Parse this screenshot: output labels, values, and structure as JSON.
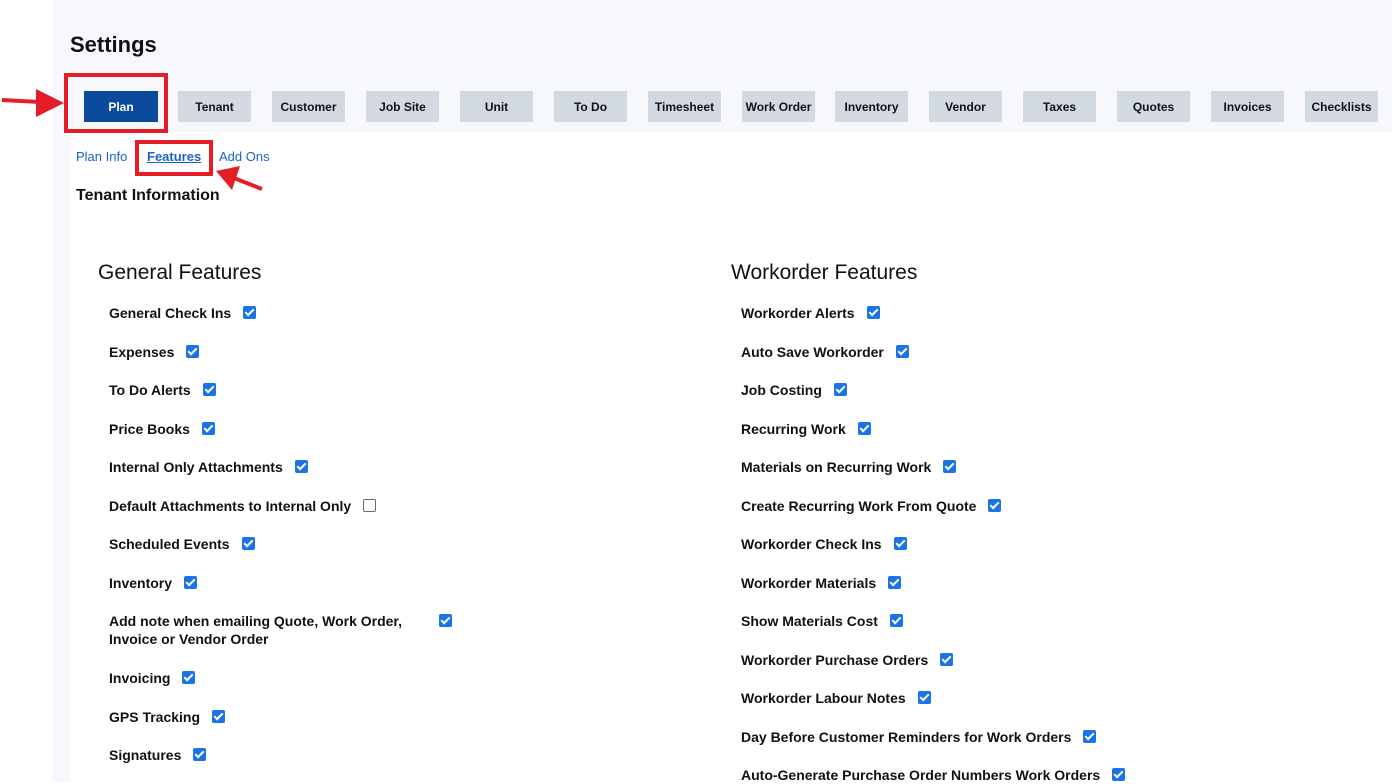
{
  "page": {
    "title": "Settings"
  },
  "tabs": [
    {
      "label": "Plan",
      "active": true
    },
    {
      "label": "Tenant"
    },
    {
      "label": "Customer"
    },
    {
      "label": "Job Site"
    },
    {
      "label": "Unit"
    },
    {
      "label": "To Do"
    },
    {
      "label": "Timesheet"
    },
    {
      "label": "Work Order"
    },
    {
      "label": "Inventory"
    },
    {
      "label": "Vendor"
    },
    {
      "label": "Taxes"
    },
    {
      "label": "Quotes"
    },
    {
      "label": "Invoices"
    },
    {
      "label": "Checklists"
    }
  ],
  "subnav": [
    {
      "label": "Plan Info"
    },
    {
      "label": "Features",
      "active": true
    },
    {
      "label": "Add Ons"
    }
  ],
  "section": {
    "title": "Tenant Information"
  },
  "general": {
    "title": "General Features",
    "items": [
      {
        "label": "General Check Ins",
        "checked": true
      },
      {
        "label": "Expenses",
        "checked": true
      },
      {
        "label": "To Do Alerts",
        "checked": true
      },
      {
        "label": "Price Books",
        "checked": true
      },
      {
        "label": "Internal Only Attachments",
        "checked": true
      },
      {
        "label": "Default Attachments to Internal Only",
        "checked": false
      },
      {
        "label": "Scheduled Events",
        "checked": true
      },
      {
        "label": "Inventory",
        "checked": true
      },
      {
        "label": "Add note when emailing Quote, Work Order, Invoice or Vendor Order",
        "checked": true
      },
      {
        "label": "Invoicing",
        "checked": true
      },
      {
        "label": "GPS Tracking",
        "checked": true
      },
      {
        "label": "Signatures",
        "checked": true
      }
    ]
  },
  "workorder": {
    "title": "Workorder Features",
    "items": [
      {
        "label": "Workorder Alerts",
        "checked": true
      },
      {
        "label": "Auto Save Workorder",
        "checked": true
      },
      {
        "label": "Job Costing",
        "checked": true
      },
      {
        "label": "Recurring Work",
        "checked": true
      },
      {
        "label": "Materials on Recurring Work",
        "checked": true
      },
      {
        "label": "Create Recurring Work From Quote",
        "checked": true
      },
      {
        "label": "Workorder Check Ins",
        "checked": true
      },
      {
        "label": "Workorder Materials",
        "checked": true
      },
      {
        "label": "Show Materials Cost",
        "checked": true
      },
      {
        "label": "Workorder Purchase Orders",
        "checked": true
      },
      {
        "label": "Workorder Labour Notes",
        "checked": true
      },
      {
        "label": "Day Before Customer Reminders for Work Orders",
        "checked": true
      },
      {
        "label": "Auto-Generate Purchase Order Numbers Work Orders",
        "checked": true
      }
    ]
  },
  "colors": {
    "accent": "#0b4a9c",
    "link": "#1a63c9",
    "checkbox": "#1a73e8",
    "highlight": "#e41e26",
    "tab_bg": "#d3d9e0"
  }
}
